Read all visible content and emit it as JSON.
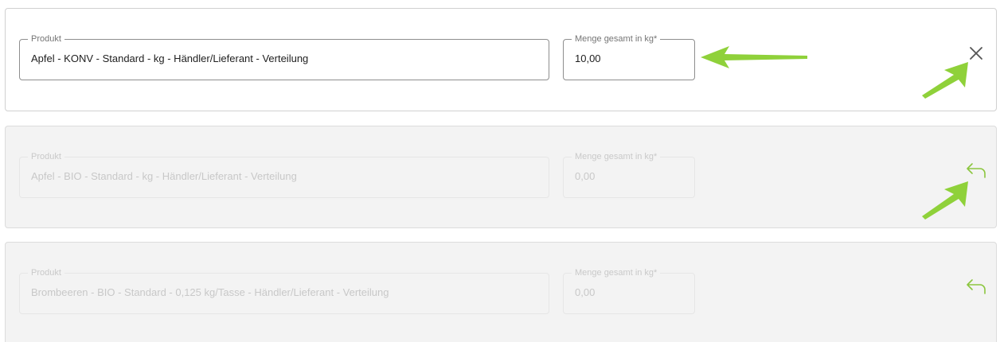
{
  "rows": [
    {
      "product_label": "Produkt",
      "product_value": "Apfel - KONV - Standard - kg - Händler/Lieferant - Verteilung",
      "qty_label": "Menge gesamt in kg*",
      "qty_value": "10,00",
      "action_icon": "close-icon",
      "state": "active"
    },
    {
      "product_label": "Produkt",
      "product_value": "Apfel - BIO - Standard - kg - Händler/Lieferant - Verteilung",
      "qty_label": "Menge gesamt in kg*",
      "qty_value": "0,00",
      "action_icon": "undo-icon",
      "state": "disabled"
    },
    {
      "product_label": "Produkt",
      "product_value": "Brombeeren - BIO - Standard - 0,125 kg/Tasse - Händler/Lieferant - Verteilung",
      "qty_label": "Menge gesamt in kg*",
      "qty_value": "0,00",
      "action_icon": "undo-icon",
      "state": "disabled"
    }
  ],
  "colors": {
    "accent_green": "#8cc63f",
    "annotation_arrow": "#8fd13a",
    "close_icon": "#555555",
    "disabled_background": "#f3f3f3"
  }
}
